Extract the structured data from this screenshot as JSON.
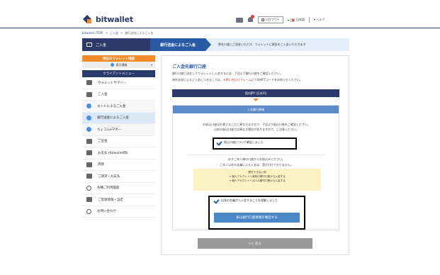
{
  "header": {
    "brand": "bitwallet",
    "logout_label": "ログアウト",
    "language_label": "日本語",
    "help_label": "ヘルプ"
  },
  "breadcrumb": {
    "items": [
      "bitwallet (TOP)",
      "ご入金",
      "銀行送金によるご入金"
    ],
    "separator": ">"
  },
  "stepbar": {
    "section": "ご入金",
    "active_step": "銀行送金によるご入金",
    "instruction": "弊社口座にご送金いただき、ウォレットに資金をご入金いただきます"
  },
  "sidebar": {
    "wallet_head": "現在のウォレット残高",
    "wallet_selected": "表示通貨",
    "menu_head": "クライアントメニュー",
    "items": [
      {
        "label": "ウォレットサマリー",
        "icon": "wallet-icon"
      },
      {
        "label": "ご入金",
        "icon": "deposit-icon"
      },
      {
        "label": "カードによるご入金",
        "icon": "card-icon",
        "sub": true
      },
      {
        "label": "銀行送金によるご入金",
        "icon": "bank-icon",
        "sub": true,
        "active": true
      },
      {
        "label": "ちょコムeマネー",
        "icon": "emoney-icon",
        "sub": true
      },
      {
        "label": "ご出金",
        "icon": "withdraw-icon"
      },
      {
        "label": "お支払 (Bitwallet間)",
        "icon": "payment-icon"
      },
      {
        "label": "両替",
        "icon": "exchange-icon"
      },
      {
        "label": "ご請求・お支払",
        "icon": "invoice-icon"
      },
      {
        "label": "各種ご利用履歴",
        "icon": "history-icon"
      },
      {
        "label": "ご登録情報・設定",
        "icon": "settings-icon"
      },
      {
        "label": "お問い合わせ",
        "icon": "help-icon"
      }
    ]
  },
  "content": {
    "title": "ご入金先銀行口座",
    "line1": "銀行口座に送金してウォレットに入金するには、下記より銀行口座をご確認ください。",
    "line2_a": "海外送金によるご入金につきましては、",
    "line2_link": "お問い合わせフォーム",
    "line2_b": "にてSWIFTコードをお知らせください。",
    "bank_bar": "国内JPY (日本円)",
    "info_head": "入金銀行情報",
    "notice1": "お振込口座はお客さまごとに異なりますので、下記より振込口座をご確認ください。",
    "notice2": "以前の振込口座とは異なる場合がありますので、ご注意ください。",
    "check1": "振込口座について確認しました",
    "rule1": "必ずご本人様の口座からお振込みください。",
    "rule2": "ご本人以外の名義による入金は、受け付けておりません。",
    "yellow_title": "受付できない例",
    "yellow_item1": "× 個人アカウントへ家族の銀行口座から入金する",
    "yellow_item2": "× 個人アカウントへ法人の銀行口座から入金する",
    "check2": "自身の名義から入金することを理解しました",
    "confirm_button": "振込銀行口座情報を確認する",
    "back_button": "<< 戻る"
  }
}
